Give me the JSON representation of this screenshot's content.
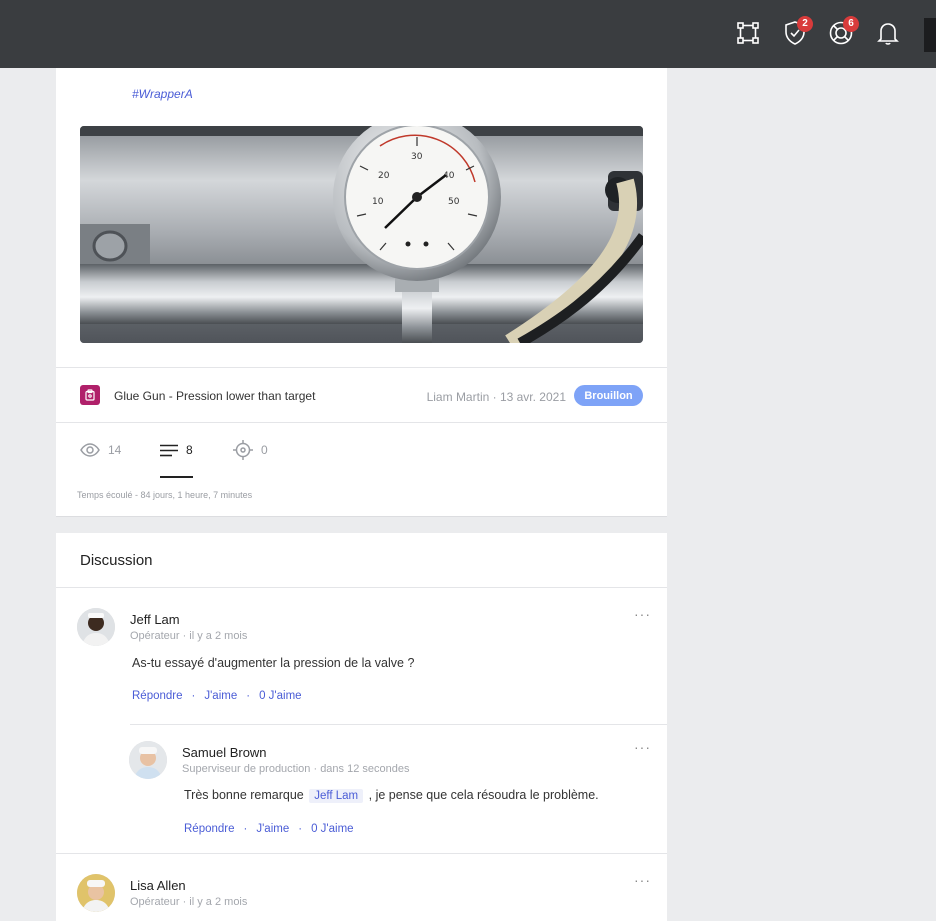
{
  "topbar": {
    "badge_shield": "2",
    "badge_help": "6",
    "icons": [
      "frame-icon",
      "shield-icon",
      "lifebuoy-icon",
      "bell-icon"
    ]
  },
  "post": {
    "hashtag": "#WrapperA",
    "issue_title": "Glue Gun - Pression lower than target",
    "issue_meta": "Liam Martin · 13 avr. 2021",
    "status": "Brouillon",
    "views": "14",
    "comments": "8",
    "targets": "0",
    "elapsed": "Temps écoulé - 84 jours, 1 heure, 7 minutes"
  },
  "discussion": {
    "title": "Discussion",
    "comments": [
      {
        "name": "Jeff Lam",
        "meta": "Opérateur · il y a 2 mois",
        "text": "As-tu essayé d'augmenter la pression de la valve ?",
        "reply": "Répondre",
        "like": "J'aime",
        "likes": "0 J'aime"
      },
      {
        "name": "Samuel Brown",
        "meta": "Superviseur de production · dans 12 secondes",
        "text_before": "Très bonne remarque",
        "mention": "Jeff Lam",
        "text_after": ", je pense que cela résoudra le problème.",
        "reply": "Répondre",
        "like": "J'aime",
        "likes": "0 J'aime"
      },
      {
        "name": "Lisa Allen",
        "meta": "Opérateur · il y a 2 mois"
      }
    ]
  },
  "colors": {
    "topbar": "#3a3d40",
    "accent": "#4a5cd6",
    "badge": "#d83b3b",
    "draft": "#7ea3f7",
    "issue_icon": "#b0206a"
  }
}
